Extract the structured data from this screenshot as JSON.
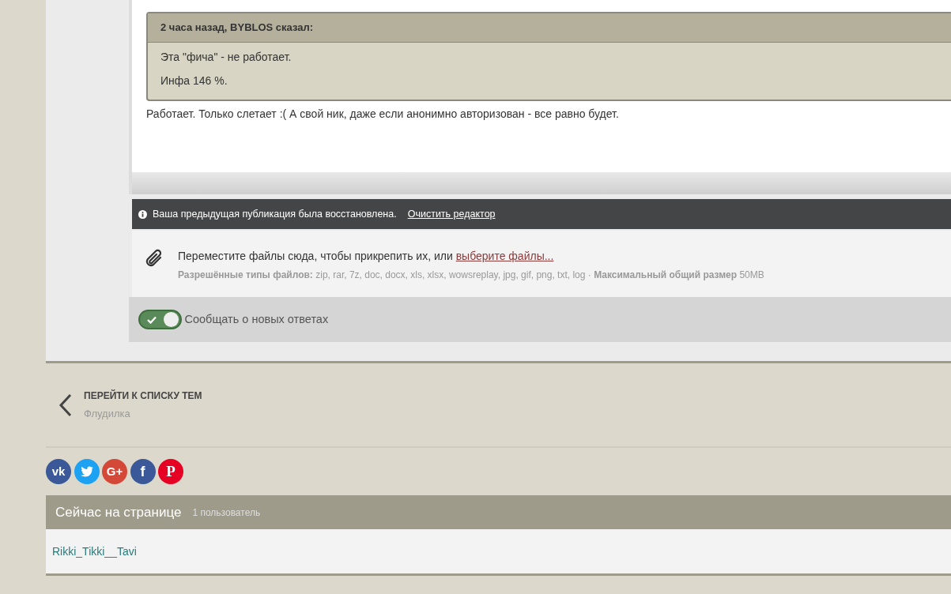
{
  "editor": {
    "quote": {
      "header": "2 часа назад, BYBLOS сказал:",
      "lines": [
        "Эта \"фича\" - не работает.",
        "Инфа 146 %."
      ]
    },
    "text": "Работает. Только слетает :( А свой ник, даже если анонимно авторизован - все равно будет."
  },
  "restore_bar": {
    "message": "Ваша предыдущая публикация была восстановлена.",
    "link": "Очистить редактор"
  },
  "attachments": {
    "prompt": "Переместите файлы сюда, чтобы прикрепить их, или",
    "link": "выберите файлы...",
    "info": "**Разрешённые типы файлов:** zip, rar, 7z, doc, docx, xls, xlsx, wowsreplay, jpg, gif, png, txt, log · **Максимальный общий размер** 50MB"
  },
  "notify_toggle": {
    "label": "Сообщать о новых ответах",
    "on": true
  },
  "back_nav": {
    "title": "ПЕРЕЙТИ К СПИСКУ ТЕМ",
    "subtitle": "Флудилка"
  },
  "share_buttons": [
    {
      "kind": "vk",
      "glyph": "vk",
      "color": "#3b5998"
    },
    {
      "kind": "twitter",
      "color": "#1da1f2"
    },
    {
      "kind": "gplus",
      "glyph": "G+",
      "color": "#d34836"
    },
    {
      "kind": "facebook",
      "glyph": "f",
      "color": "#3b5998"
    },
    {
      "kind": "pinterest",
      "glyph": "P",
      "color": "#e60023"
    }
  ],
  "online": {
    "title": "Сейчас на странице",
    "count": "1 пользователь",
    "users": [
      "Rikki_Tikki__Tavi"
    ]
  }
}
